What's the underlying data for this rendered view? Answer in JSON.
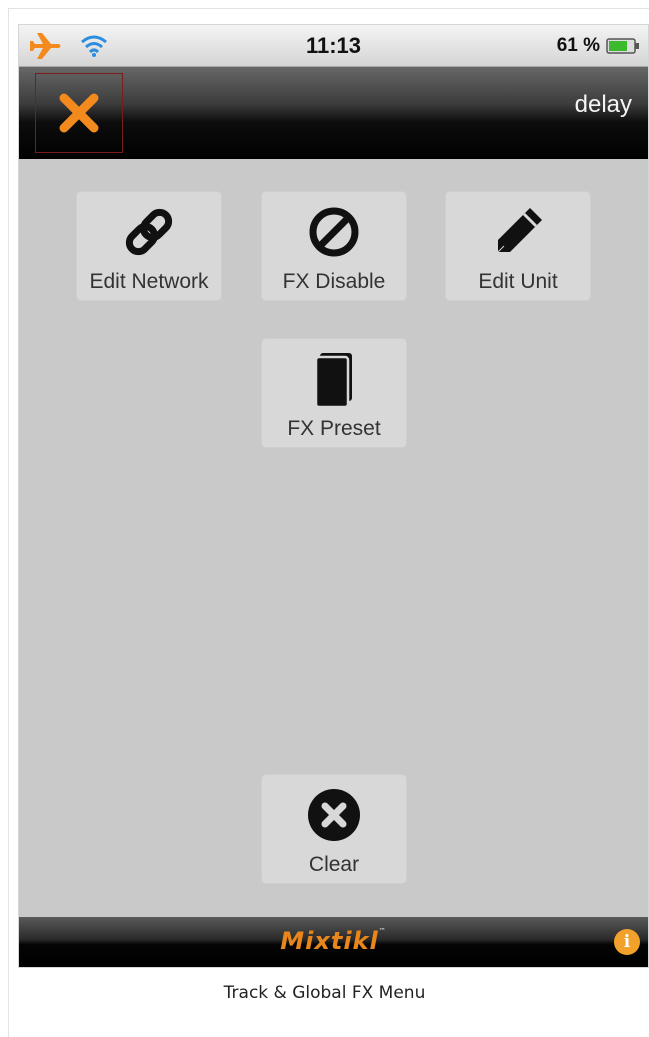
{
  "status_bar": {
    "time": "11:13",
    "battery": "61 %",
    "icons": [
      "airplane-icon",
      "wifi-icon",
      "battery-icon"
    ]
  },
  "nav_bar": {
    "close_icon": "close-icon",
    "title": "delay",
    "accent_color": "#f28a1e"
  },
  "menu": {
    "edit_network": {
      "label": "Edit Network",
      "icon": "link-icon"
    },
    "fx_disable": {
      "label": "FX Disable",
      "icon": "disable-icon"
    },
    "edit_unit": {
      "label": "Edit Unit",
      "icon": "pencil-icon"
    },
    "fx_preset": {
      "label": "FX Preset",
      "icon": "book-icon"
    },
    "clear": {
      "label": "Clear",
      "icon": "clear-icon"
    }
  },
  "footer": {
    "brand": "Mixtikl",
    "info_icon": "info-icon",
    "brand_color": "#e8861c"
  },
  "caption": "Track & Global FX Menu"
}
